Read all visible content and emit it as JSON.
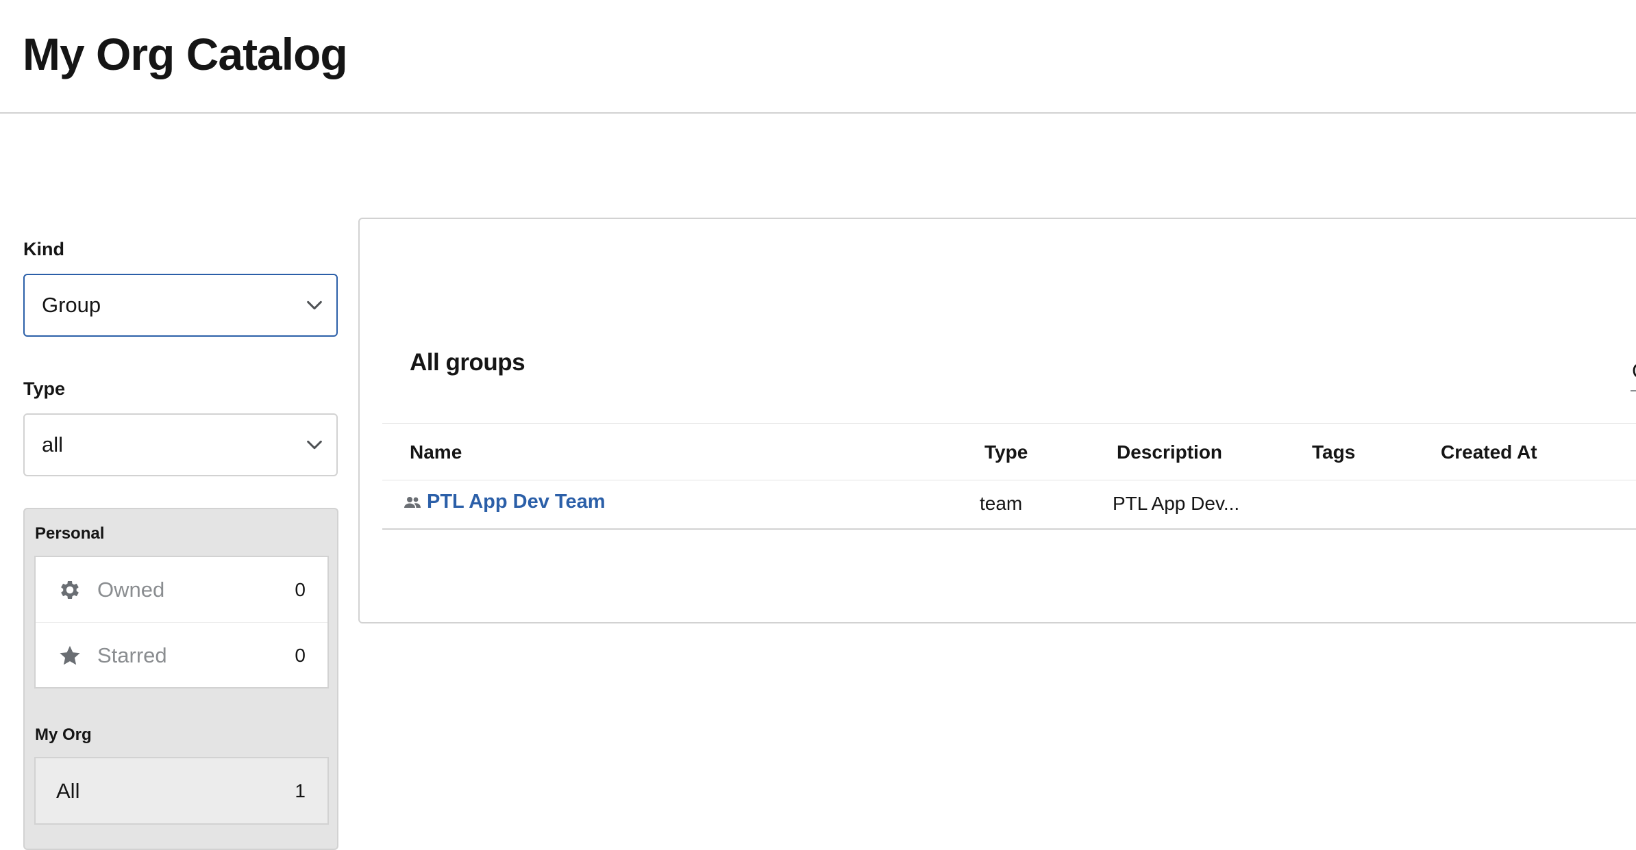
{
  "header": {
    "title": "My Org Catalog"
  },
  "filters": {
    "kind": {
      "label": "Kind",
      "value": "Group"
    },
    "type": {
      "label": "Type",
      "value": "all"
    }
  },
  "user_filter": {
    "personal_label": "Personal",
    "personal_items": [
      {
        "label": "Owned",
        "count": "0",
        "icon": "gear-icon"
      },
      {
        "label": "Starred",
        "count": "0",
        "icon": "star-icon"
      }
    ],
    "org_label": "My Org",
    "org_items": [
      {
        "label": "All",
        "count": "1",
        "selected": true
      }
    ]
  },
  "table": {
    "title": "All groups",
    "toolbar_partial": "C",
    "columns": [
      "Name",
      "Type",
      "Description",
      "Tags",
      "Created At"
    ],
    "rows": [
      {
        "icon": "group-icon",
        "name": "PTL App Dev Team",
        "type": "team",
        "description": "PTL App Dev...",
        "tags": "",
        "created_at": ""
      }
    ]
  },
  "colors": {
    "link": "#2b5fa8",
    "focus_border": "#2b5fa8",
    "border": "#d2d2d2",
    "panel_bg": "#e4e4e4",
    "muted_text": "#8a8d90"
  }
}
